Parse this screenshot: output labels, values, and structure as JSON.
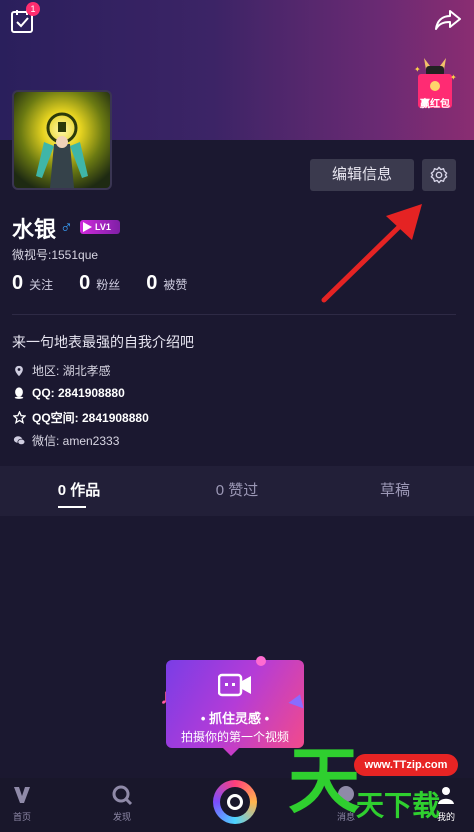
{
  "header": {
    "notification_count": "1",
    "redpacket_label": "赢红包"
  },
  "profile": {
    "name": "水银",
    "level": "LV1",
    "weishi_id": "微视号:1551que",
    "edit_label": "编辑信息",
    "stats": [
      {
        "num": "0",
        "label": "关注"
      },
      {
        "num": "0",
        "label": "粉丝"
      },
      {
        "num": "0",
        "label": "被赞"
      }
    ],
    "bio": "来一句地表最强的自我介绍吧",
    "region": "地区: 湖北孝感",
    "qq": "QQ: 2841908880",
    "qzone": "QQ空间: 2841908880",
    "wechat": "微信: amen2333"
  },
  "tabs": [
    {
      "label": "0 作品",
      "active": true
    },
    {
      "label": "0 赞过",
      "active": false
    },
    {
      "label": "草稿",
      "active": false
    }
  ],
  "promo": {
    "title": "• 抓住灵感 •",
    "subtitle": "拍摄你的第一个视频"
  },
  "bottom_nav": [
    {
      "label": "首页",
      "icon": "home-icon"
    },
    {
      "label": "发现",
      "icon": "discover-icon"
    },
    {
      "label": "消息",
      "icon": "message-icon"
    },
    {
      "label": "我的",
      "icon": "me-icon",
      "active": true
    }
  ],
  "watermark": {
    "big": "天",
    "url": "www.TTzip.com",
    "sub": "天下载"
  },
  "colors": {
    "accent_pink": "#ff2d6f",
    "gender_blue": "#3aa4ff",
    "arrow_red": "#e52323"
  }
}
